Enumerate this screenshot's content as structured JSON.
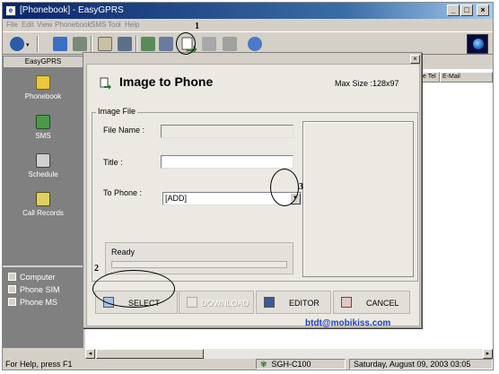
{
  "window": {
    "title": "[Phonebook] - EasyGPRS",
    "controls": {
      "minimize": "_",
      "maximize": "□",
      "close": "×"
    }
  },
  "menu": [
    "File",
    "Edit",
    "View",
    "Phonebook",
    "SMS",
    "Tool",
    "Help"
  ],
  "toolbar": {
    "buttons": [
      "phone-dropdown-icon",
      "phone-icon",
      "book-icon",
      "email-icon",
      "printer-icon",
      "sim-icon",
      "transfer-icon",
      "image-to-phone-icon",
      "image-icon",
      "sound-icon",
      "internet-icon"
    ],
    "active_button": "image-to-phone-icon"
  },
  "sidebar": {
    "title": "EasyGPRS",
    "items": [
      {
        "label": "Phonebook",
        "icon": "phonebook-icon"
      },
      {
        "label": "SMS",
        "icon": "sms-icon"
      },
      {
        "label": "Schedule",
        "icon": "schedule-icon"
      },
      {
        "label": "Call Records",
        "icon": "call-records-icon"
      }
    ],
    "phone_items": [
      "Computer",
      "Phone SIM",
      "Phone MS"
    ]
  },
  "list": {
    "columns": [
      "e Tel",
      "E-Mail"
    ]
  },
  "status": {
    "help": "For Help, press F1",
    "model": "SGH-C100",
    "datetime": "Saturday, August 09, 2003 03:05"
  },
  "dialog": {
    "title": "Image to Phone",
    "max_size": "Max Size :128x97",
    "group_label": "Image File",
    "file_name_label": "File Name :",
    "file_name_value": "",
    "title_label": "Title :",
    "title_value": "",
    "to_phone_label": "To Phone :",
    "to_phone_value": "[ADD]",
    "progress_label": "Ready",
    "progress": 0,
    "buttons": {
      "select": "SELECT",
      "download": "DOWNLOAD",
      "editor": "EDITOR",
      "cancel": "CANCEL"
    }
  },
  "watermark": "btdt@mobikiss.com",
  "annotations": {
    "n1": "1",
    "n2": "2",
    "n3": "3"
  },
  "colors": {
    "title_bar": "#0a246a",
    "watermark": "#1a3fbf",
    "sidebar": "#808080"
  }
}
